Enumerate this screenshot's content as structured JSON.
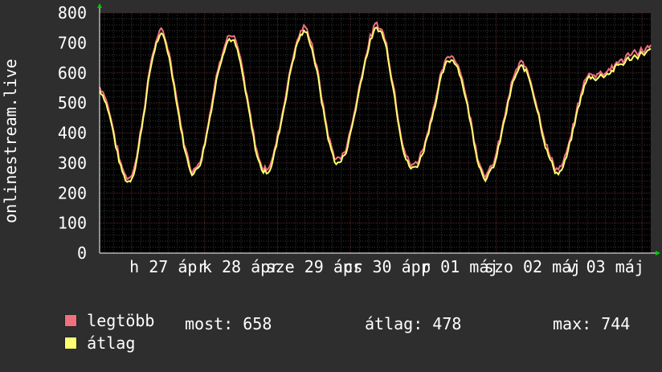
{
  "chart_data": {
    "type": "line",
    "ylabel": "onlinestream.live",
    "ylim": [
      0,
      800
    ],
    "yticks": [
      0,
      100,
      200,
      300,
      400,
      500,
      600,
      700,
      800
    ],
    "xticks": [
      "h 27 ápr",
      "k 28 ápr",
      "sze 29 ápr",
      "cs 30 ápr",
      "p 01 máj",
      "szo 02 máj",
      "v 03 máj"
    ],
    "grid": true,
    "background": "#000000",
    "x_range_days": [
      26.56,
      34.12
    ],
    "series": [
      {
        "name": "legtöbb",
        "color": "#f07080",
        "x": [],
        "values": []
      },
      {
        "name": "átlag",
        "color": "#ffff70",
        "x": [],
        "values": []
      }
    ],
    "daily_peaks": [
      {
        "day": 26.56,
        "value": 540
      },
      {
        "day": 26.95,
        "value": 240
      },
      {
        "day": 27.4,
        "value": 720
      },
      {
        "day": 27.85,
        "value": 270
      },
      {
        "day": 28.35,
        "value": 715
      },
      {
        "day": 28.83,
        "value": 270
      },
      {
        "day": 29.37,
        "value": 735
      },
      {
        "day": 29.83,
        "value": 300
      },
      {
        "day": 30.38,
        "value": 745
      },
      {
        "day": 30.85,
        "value": 280
      },
      {
        "day": 31.4,
        "value": 645
      },
      {
        "day": 31.87,
        "value": 255
      },
      {
        "day": 32.35,
        "value": 615
      },
      {
        "day": 32.85,
        "value": 270
      },
      {
        "day": 33.3,
        "value": 585
      },
      {
        "day": 34.12,
        "value": 670
      }
    ]
  },
  "legend": {
    "items": [
      {
        "label": "legtöbb",
        "color": "#f07080"
      },
      {
        "label": "átlag",
        "color": "#ffff70"
      }
    ],
    "stats": {
      "now": "most: 658",
      "avg": "átlag: 478",
      "max": "max: 744"
    }
  },
  "colors": {
    "page_bg": "#2e2e2e",
    "plot_bg": "#000000",
    "grid_major": "#5a2a2a",
    "grid_minor": "#3a3a3a",
    "axis_arrow": "#00cc00"
  }
}
